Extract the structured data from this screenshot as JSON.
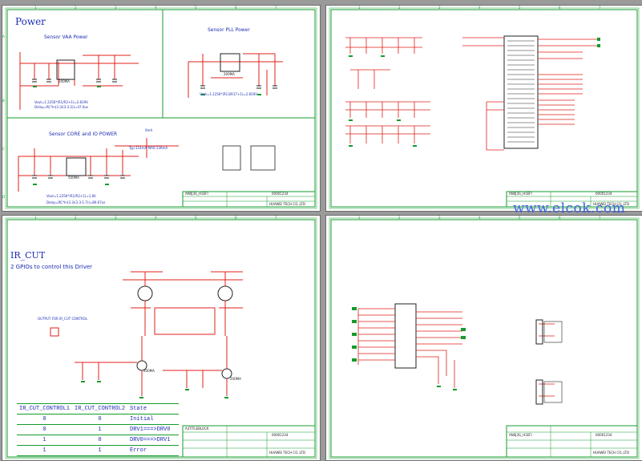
{
  "sheets": {
    "power": {
      "title": "Power",
      "vaa_title": "Sensor VAA Power",
      "pll_title": "Sensor PLL Power",
      "core_title": "Sensor CORE and IO POWER",
      "vaa_eq1": "Vout=1.2256*(R1/R2+1)=2.819V",
      "vaa_eq2": "Delay=RC*ln(3.3/(3.3-2))=47.6us",
      "pll_eq1": "Vout=1.2256*(R13/R17+1)=2.819V",
      "core_eq1": "Vout=1.2256*(R1/R2+1)=1.8V",
      "core_eq2": "Delay=RC*ln(3.3/(3.3-1.7))=86.67us",
      "core_typ": "Typ:114mA MAX:136mA",
      "chip_200ma_a": "200MA",
      "chip_200ma_b": "200MA",
      "chip_500ma": "500MA",
      "label_0ma": "0mA",
      "part_no": "AN0J3G_H1EFI",
      "doc_no": "00001234",
      "company": "HUAWEI TECH CO.,LTD"
    },
    "sensor": {
      "part_no": "AN0J3G_H1EFI",
      "doc_no": "00001234",
      "company": "HUAWEI TECH CO.,LTD"
    },
    "ir_cut": {
      "title": "IR_CUT",
      "subtitle": "2 GPIOs to control this Driver",
      "output_label": "OUTPUT FOR IR_CUT CONTROL",
      "chip_a": "200MA",
      "chip_b": "200MA",
      "table": {
        "headers": [
          "IR_CUT_CONTROL1",
          "IR_CUT_CONTROL2",
          "State"
        ],
        "rows": [
          [
            "0",
            "0",
            "Initial"
          ],
          [
            "0",
            "1",
            "DRV1===>DRV0"
          ],
          [
            "1",
            "0",
            "DRV0===>DRV1"
          ],
          [
            "1",
            "1",
            "Error"
          ]
        ]
      },
      "part_no": "A3TITLEBLOCK",
      "doc_no": "00001234",
      "company": "HUAWEI TECH CO.,LTD"
    },
    "connector": {
      "part_no": "AN0J3G_H1EFI",
      "doc_no": "00001234",
      "company": "HUAWEI TECH CO.,LTD"
    }
  },
  "watermark": "www.elcok.com",
  "colors": {
    "wire": "#e0201b",
    "border": "#159b2c",
    "text": "#1c2db3",
    "component": "#222222"
  }
}
